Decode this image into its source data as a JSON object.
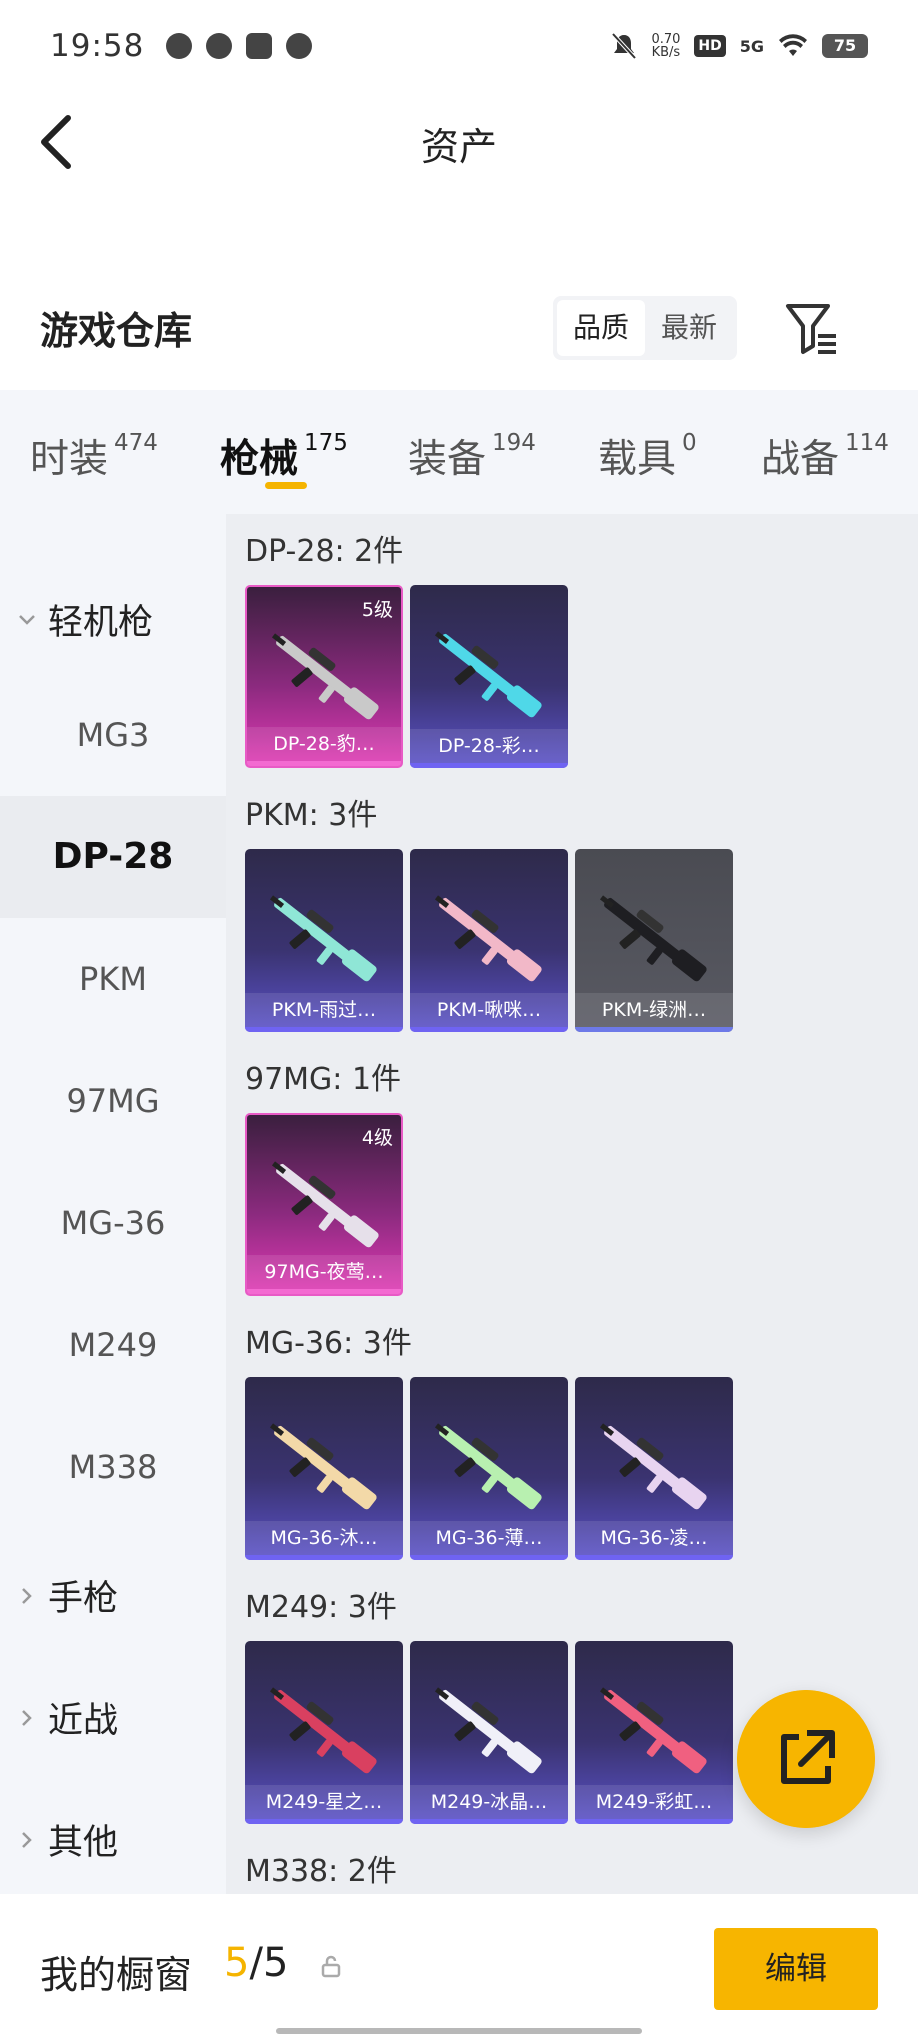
{
  "status_bar": {
    "time": "19:58",
    "net_speed_value": "0.70",
    "net_speed_unit": "KB/s",
    "hd": "HD",
    "network": "5G",
    "battery": "75"
  },
  "header": {
    "title": "资产"
  },
  "warehouse": {
    "title": "游戏仓库",
    "sort_options": [
      "品质",
      "最新"
    ],
    "sort_selected": "品质"
  },
  "tabs": [
    {
      "label": "时装",
      "count": "474"
    },
    {
      "label": "枪械",
      "count": "175",
      "active": true
    },
    {
      "label": "装备",
      "count": "194"
    },
    {
      "label": "载具",
      "count": "0"
    },
    {
      "label": "战备",
      "count": "114"
    }
  ],
  "sidebar": {
    "group_lmg": "轻机枪",
    "items": [
      "MG3",
      "DP-28",
      "PKM",
      "97MG",
      "MG-36",
      "M249",
      "M338"
    ],
    "selected": "DP-28",
    "group_pistol": "手枪",
    "group_melee": "近战",
    "group_other": "其他"
  },
  "sections": [
    {
      "title": "DP-28: 2件",
      "cards": [
        {
          "name": "DP-28-豹…",
          "level": "5级",
          "tier": "pink",
          "accent": "#c9c9c9"
        },
        {
          "name": "DP-28-彩…",
          "level": "",
          "tier": "purple",
          "accent": "#4fd8e8"
        }
      ]
    },
    {
      "title": "PKM: 3件",
      "cards": [
        {
          "name": "PKM-雨过…",
          "level": "",
          "tier": "purple",
          "accent": "#8fe6d6"
        },
        {
          "name": "PKM-啾咪…",
          "level": "",
          "tier": "purple",
          "accent": "#f2b8c8"
        },
        {
          "name": "PKM-绿洲…",
          "level": "",
          "tier": "gray",
          "accent": "#1e1e22"
        }
      ]
    },
    {
      "title": "97MG: 1件",
      "cards": [
        {
          "name": "97MG-夜莺…",
          "level": "4级",
          "tier": "pink",
          "accent": "#e6e0ea"
        }
      ]
    },
    {
      "title": "MG-36: 3件",
      "cards": [
        {
          "name": "MG-36-沐…",
          "level": "",
          "tier": "purple",
          "accent": "#f3d9a8"
        },
        {
          "name": "MG-36-薄…",
          "level": "",
          "tier": "purple",
          "accent": "#b8f0b0"
        },
        {
          "name": "MG-36-凌…",
          "level": "",
          "tier": "purple",
          "accent": "#e8d4f0"
        }
      ]
    },
    {
      "title": "M249: 3件",
      "cards": [
        {
          "name": "M249-星之…",
          "level": "",
          "tier": "purple",
          "accent": "#d94060"
        },
        {
          "name": "M249-冰晶…",
          "level": "",
          "tier": "purple",
          "accent": "#f0f0f8"
        },
        {
          "name": "M249-彩虹…",
          "level": "",
          "tier": "purple",
          "accent": "#f06080"
        }
      ]
    },
    {
      "title": "M338: 2件",
      "cards": []
    }
  ],
  "bottom": {
    "showcase_label": "我的橱窗",
    "showcase_current": "5",
    "showcase_sep": "/",
    "showcase_total": "5",
    "edit_label": "编辑"
  },
  "colors": {
    "accent": "#f7b500",
    "purple_card": "#3a3370",
    "pink_card": "#e03ab4"
  }
}
